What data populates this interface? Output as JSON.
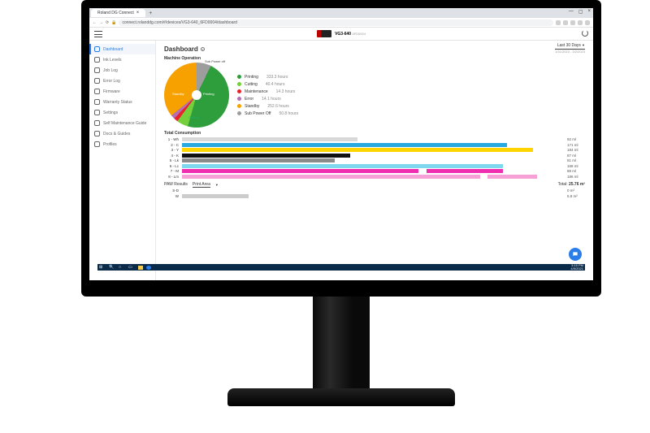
{
  "browser": {
    "tab_title": "Roland DG Connect",
    "url": "connect.rolanddg.com/#/devices/VG3-640_6FD0004/dashboard"
  },
  "header": {
    "device_name": "VG3-640",
    "serial": "6FD0004"
  },
  "sidebar": {
    "items": [
      {
        "label": "Dashboard",
        "active": true
      },
      {
        "label": "Ink Levels"
      },
      {
        "label": "Job Log"
      },
      {
        "label": "Error Log"
      },
      {
        "label": "Firmware"
      },
      {
        "label": "Warranty Status"
      },
      {
        "label": "Settings"
      },
      {
        "label": "Self Maintenance Guide"
      },
      {
        "label": "Docs & Guides"
      },
      {
        "label": "Profiles"
      }
    ]
  },
  "page": {
    "title": "Dashboard",
    "period_label": "Last 30 Days",
    "period_range": "1/31/2023 - 3/2/2023"
  },
  "machine_operation": {
    "title": "Machine Operation",
    "legend": [
      {
        "label": "Printing",
        "value": "333.3 hours",
        "color": "#2e9e3c"
      },
      {
        "label": "Cutting",
        "value": "40.4 hours",
        "color": "#74d03a"
      },
      {
        "label": "Maintenance",
        "value": "14.3 hours",
        "color": "#e8222a"
      },
      {
        "label": "Error",
        "value": "14.1 hours",
        "color": "#b56db3"
      },
      {
        "label": "Standby",
        "value": "252.6 hours",
        "color": "#f7a100"
      },
      {
        "label": "Sub Power Off",
        "value": "50.8 hours",
        "color": "#9d9d9d"
      }
    ]
  },
  "chart_data": {
    "type": "pie",
    "title": "Machine Operation",
    "series": [
      {
        "name": "Printing",
        "value": 333.3,
        "color": "#2e9e3c"
      },
      {
        "name": "Cutting",
        "value": 40.4,
        "color": "#74d03a"
      },
      {
        "name": "Maintenance",
        "value": 14.3,
        "color": "#e8222a"
      },
      {
        "name": "Error",
        "value": 14.1,
        "color": "#b56db3"
      },
      {
        "name": "Standby",
        "value": 252.6,
        "color": "#f7a100"
      },
      {
        "name": "Sub Power Off",
        "value": 50.8,
        "color": "#9d9d9d"
      }
    ],
    "pie_labels": {
      "printing": "Printing",
      "standby": "Standby",
      "cutting": "Cutting",
      "suboff": "Sub Power off"
    }
  },
  "consumption": {
    "title": "Total Consumption",
    "max": 200,
    "rows": [
      {
        "label": "1 - Wh",
        "value": 92,
        "unit": "ml",
        "segments": [
          {
            "color": "#d9d9d9",
            "width": 46
          }
        ]
      },
      {
        "label": "2 - C",
        "value": 171,
        "unit": "ml",
        "segments": [
          {
            "color": "#29a9e0",
            "width": 85
          }
        ]
      },
      {
        "label": "3 - Y",
        "value": 184,
        "unit": "ml",
        "segments": [
          {
            "color": "#ffd400",
            "width": 92
          }
        ]
      },
      {
        "label": "4 - K",
        "value": 87,
        "unit": "ml",
        "segments": [
          {
            "color": "#111111",
            "width": 44
          }
        ]
      },
      {
        "label": "5 - Lk",
        "value": 81,
        "unit": "ml",
        "segments": [
          {
            "color": "#8a8a8a",
            "width": 40
          }
        ]
      },
      {
        "label": "6 - Lc",
        "value": 168,
        "unit": "ml",
        "segments": [
          {
            "color": "#7fd6ef",
            "width": 84
          }
        ]
      },
      {
        "label": "7 - M",
        "value": 88,
        "unit": "ml",
        "segments": [
          {
            "color": "#ef2fb0",
            "width": 62
          },
          {
            "color": "#ef2fb0",
            "width": 20
          }
        ]
      },
      {
        "label": "8 - Lm",
        "value": 186,
        "unit": "ml",
        "segments": [
          {
            "color": "#f7a0d7",
            "width": 78
          },
          {
            "color": "#f7a0d7",
            "width": 13
          }
        ]
      }
    ]
  },
  "paw": {
    "title": "PAW Results",
    "selector": "Print Area",
    "total_label": "Total:",
    "total_value": "25.76 m²",
    "rows": [
      {
        "label": "S-D",
        "value": 0.0,
        "unit": "m²"
      },
      {
        "label": "W",
        "value": 5.8,
        "unit": "m²"
      }
    ]
  },
  "taskbar": {
    "time": "3:15 PM",
    "date": "4/5/2021"
  }
}
